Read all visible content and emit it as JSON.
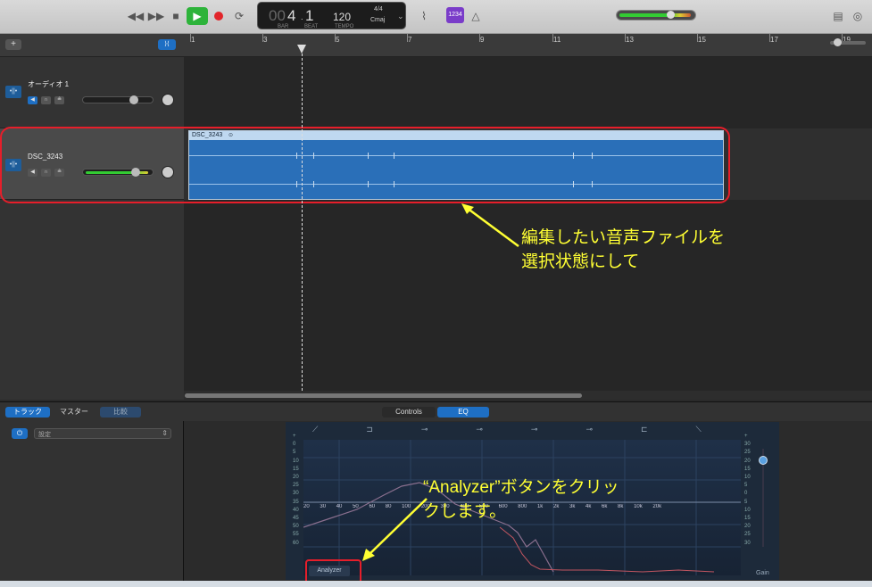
{
  "toolbar": {
    "lcd": {
      "bar": "4",
      "beat": "1",
      "tempo": "120",
      "sig_top": "4/4",
      "key": "Cmaj",
      "bar_label": "BAR",
      "beat_label": "BEAT",
      "tempo_label": "TEMPO",
      "prefix": "00"
    },
    "purple_label": "1234"
  },
  "ruler": {
    "bars": [
      "1",
      "3",
      "5",
      "7",
      "9",
      "11",
      "13",
      "15",
      "17",
      "19"
    ]
  },
  "tracks": [
    {
      "name": "オーディオ 1",
      "fader": 0.7
    },
    {
      "name": "DSC_3243",
      "fader": 0.72
    }
  ],
  "region": {
    "name": "DSC_3243"
  },
  "annotations": {
    "track_line1": "編集したい音声ファイルを",
    "track_line2": "選択状態にして",
    "analyzer_line1": "“Analyzer”ボタンをクリッ",
    "analyzer_line2": "クします。"
  },
  "editor": {
    "tabs_left": {
      "track": "トラック",
      "master": "マスター",
      "compare": "比較"
    },
    "tabs_mid": {
      "controls": "Controls",
      "eq": "EQ"
    },
    "setting_label": "設定",
    "analyzer_button": "Analyzer",
    "gain_label": "Gain",
    "freq_labels": [
      "20",
      "30",
      "40",
      "50",
      "60",
      "80",
      "100",
      "200",
      "300",
      "400",
      "500",
      "600",
      "800",
      "1k",
      "2k",
      "3k",
      "4k",
      "6k",
      "8k",
      "10k",
      "20k"
    ],
    "db_left": [
      "+",
      "0",
      "5",
      "10",
      "15",
      "20",
      "25",
      "30",
      "35",
      "40",
      "45",
      "50",
      "55",
      "60"
    ],
    "db_right": [
      "+",
      "30",
      "25",
      "20",
      "15",
      "10",
      "5",
      "0",
      "5",
      "10",
      "15",
      "20",
      "25",
      "30"
    ]
  },
  "colors": {
    "accent": "#1e6fc4",
    "annotation": "#ffff33",
    "highlight_box": "#e61e2a",
    "play": "#2db33a"
  }
}
